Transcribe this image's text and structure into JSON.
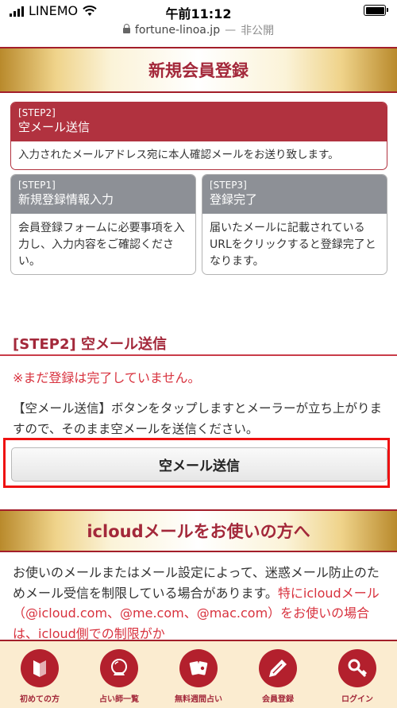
{
  "status_bar": {
    "carrier": "LINEMO",
    "time": "午前11:12"
  },
  "url_bar": {
    "url": "fortune-linoa.jp",
    "separator": "—",
    "privacy": "非公開"
  },
  "page_title": "新規会員登録",
  "steps": {
    "active": {
      "step": "[STEP2]",
      "title": "空メール送信",
      "description": "入力されたメールアドレス宛に本人確認メールをお送り致します。"
    },
    "step1": {
      "step": "[STEP1]",
      "title": "新規登録情報入力",
      "description": "会員登録フォームに必要事項を入力し、入力内容をご確認ください。"
    },
    "step3": {
      "step": "[STEP3]",
      "title": "登録完了",
      "description": "届いたメールに記載されているURLをクリックすると登録完了となります。"
    }
  },
  "section": {
    "title": "[STEP2] 空メール送信",
    "notice": "※まだ登録は完了していません。",
    "instruction": "【空メール送信】ボタンをタップしますとメーラーが立ち上がりますので、そのまま空メールを送信ください。",
    "button_label": "空メール送信"
  },
  "icloud": {
    "title": "icloudメールをお使いの方へ",
    "text": "お使いのメールまたはメール設定によって、迷惑メール防止のためメール受信を制限している場合があります。",
    "text_red": "特にicloudメール（@icloud.com、@me.com、@mac.com）をお使いの場合は、icloud側での制限がか"
  },
  "tabbar": [
    {
      "label": "初めての方",
      "icon": "beginner-mark-icon"
    },
    {
      "label": "占い師一覧",
      "icon": "crystal-ball-icon"
    },
    {
      "label": "無料週間占い",
      "icon": "tarot-cards-icon"
    },
    {
      "label": "会員登録",
      "icon": "pen-icon"
    },
    {
      "label": "ログイン",
      "icon": "key-icon"
    }
  ],
  "colors": {
    "brand_red": "#a3283a",
    "step_active": "#b1323f",
    "step_inactive": "#8d9096",
    "notice_red": "#d8323e",
    "highlight": "#ee1111"
  }
}
